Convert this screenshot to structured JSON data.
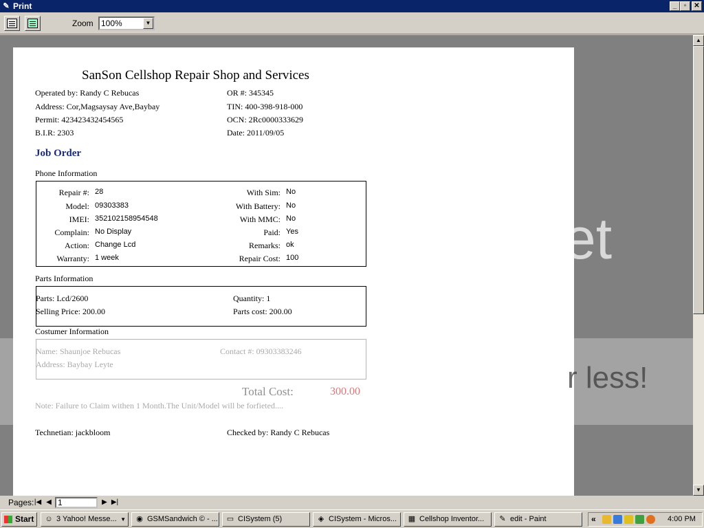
{
  "window": {
    "title": "Print"
  },
  "toolbar": {
    "zoom_label": "Zoom",
    "zoom_value": "100%"
  },
  "report": {
    "shop_name": "SanSon Cellshop Repair Shop and Services",
    "operated_by": "Operated by: Randy C Rebucas",
    "or_no": "OR #: 345345",
    "address": "Address: Cor,Magsaysay Ave,Baybay",
    "tin": "TIN: 400-398-918-000",
    "permit": "Permit: 423423432454565",
    "ocn": "OCN: 2Rc0000333629",
    "bir": "B.I.R: 2303",
    "date": "Date: 2011/09/05",
    "job_order": "Job Order",
    "phone_section": "Phone Information",
    "phone_left": [
      {
        "label": "Repair #:",
        "value": "28"
      },
      {
        "label": "Model:",
        "value": "09303383"
      },
      {
        "label": "IMEI:",
        "value": "352102158954548"
      },
      {
        "label": "Complain:",
        "value": "No Display"
      },
      {
        "label": "Action:",
        "value": "Change Lcd"
      },
      {
        "label": "Warranty:",
        "value": "1 week"
      }
    ],
    "phone_right": [
      {
        "label": "With Sim:",
        "value": "No"
      },
      {
        "label": "With Battery:",
        "value": "No"
      },
      {
        "label": "With MMC:",
        "value": "No"
      },
      {
        "label": "Paid:",
        "value": "Yes"
      },
      {
        "label": "Remarks:",
        "value": "ok"
      },
      {
        "label": "Repair Cost:",
        "value": "100"
      }
    ],
    "parts_section": "Parts Information",
    "parts": "Parts: Lcd/2600",
    "quantity": "Quantity: 1",
    "selling_price": "Selling Price: 200.00",
    "parts_cost": "Parts cost: 200.00",
    "customer_section": "Costumer Information",
    "customer_name": "Name: Shaunjoe Rebucas",
    "contact": "Contact #: 09303383246",
    "customer_address": "Address: Baybay Leyte",
    "total_label": "Total Cost:",
    "total_value": "300.00",
    "note": "Note: Failure to Claim withen 1 Month.The Unit/Model will be forfieted....",
    "technician": "Technetian: jackbloom",
    "checked_by": "Checked by: Randy C Rebucas"
  },
  "watermark": {
    "line1": "et",
    "line2": "r less!"
  },
  "pagesbar": {
    "label": "Pages:",
    "current": "1"
  },
  "taskbar": {
    "start": "Start",
    "tasks": [
      {
        "label": "3 Yahoo! Messe...",
        "icon": "yahoo-messenger-icon"
      },
      {
        "label": "GSMSandwich © - ...",
        "icon": "chrome-icon"
      },
      {
        "label": "CISystem (5)",
        "icon": "folder-icon"
      },
      {
        "label": "CISystem - Micros...",
        "icon": "visual-studio-icon"
      },
      {
        "label": "Cellshop Inventor...",
        "icon": "app-icon"
      },
      {
        "label": "edit - Paint",
        "icon": "paint-icon"
      }
    ],
    "clock": "4:00 PM"
  },
  "colors": {
    "titlebar": "#0a246a",
    "job_order": "#1a2a7a",
    "total_value": "#d04040"
  }
}
